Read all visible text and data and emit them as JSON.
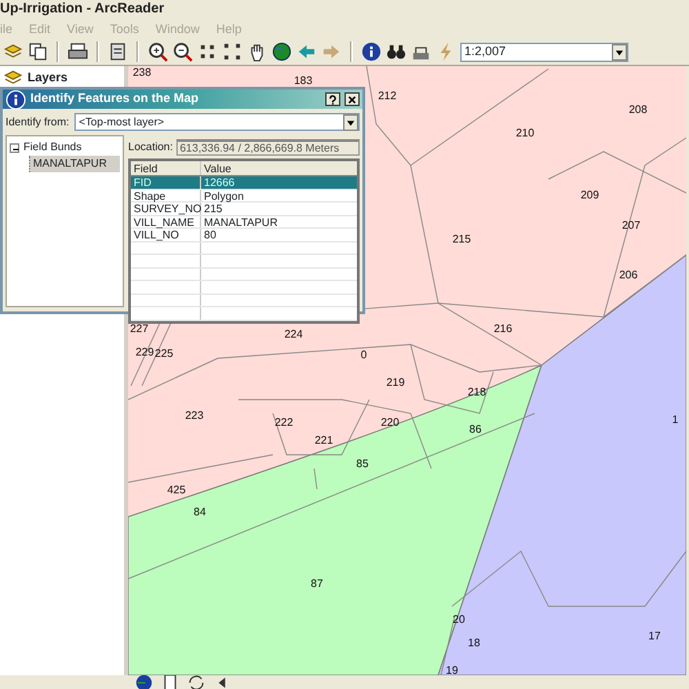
{
  "window": {
    "title": "Up-Irrigation - ArcReader"
  },
  "menu": [
    {
      "label": "ile",
      "disabled": true
    },
    {
      "label": "Edit",
      "disabled": true
    },
    {
      "label": "View",
      "disabled": true
    },
    {
      "label": "Tools",
      "disabled": true
    },
    {
      "label": "Window",
      "disabled": true
    },
    {
      "label": "Help",
      "disabled": true
    }
  ],
  "toolbar": {
    "scale": "1:2,007"
  },
  "toc": {
    "title": "Layers"
  },
  "dialog": {
    "title": "Identify Features on the Map",
    "identify_from_label": "Identify from:",
    "identify_from_value": "<Top-most layer>",
    "tree": [
      {
        "label": "Field Bunds",
        "expanded": true,
        "children": [
          {
            "label": "MANALTAPUR",
            "selected": true
          }
        ]
      }
    ],
    "location_label": "Location:",
    "location_value": "613,336.94 / 2,866,669.8 Meters",
    "columns": [
      "Field",
      "Value"
    ],
    "rows": [
      {
        "field": "FID",
        "value": "12666",
        "selected": true
      },
      {
        "field": "Shape",
        "value": "Polygon",
        "selected": false
      },
      {
        "field": "SURVEY_NO",
        "value": "215",
        "selected": false
      },
      {
        "field": "VILL_NAME",
        "value": "MANALTAPUR",
        "selected": false
      },
      {
        "field": "VILL_NO",
        "value": "80",
        "selected": false
      }
    ]
  },
  "map": {
    "labels": [
      "238",
      "183",
      "212",
      "208",
      "210",
      "209",
      "207",
      "215",
      "206",
      "227",
      "224",
      "216",
      "229",
      "225",
      "0",
      "219",
      "218",
      "223",
      "222",
      "220",
      "1",
      "86",
      "221",
      "85",
      "425",
      "84",
      "87",
      "20",
      "18",
      "17",
      "19"
    ]
  }
}
